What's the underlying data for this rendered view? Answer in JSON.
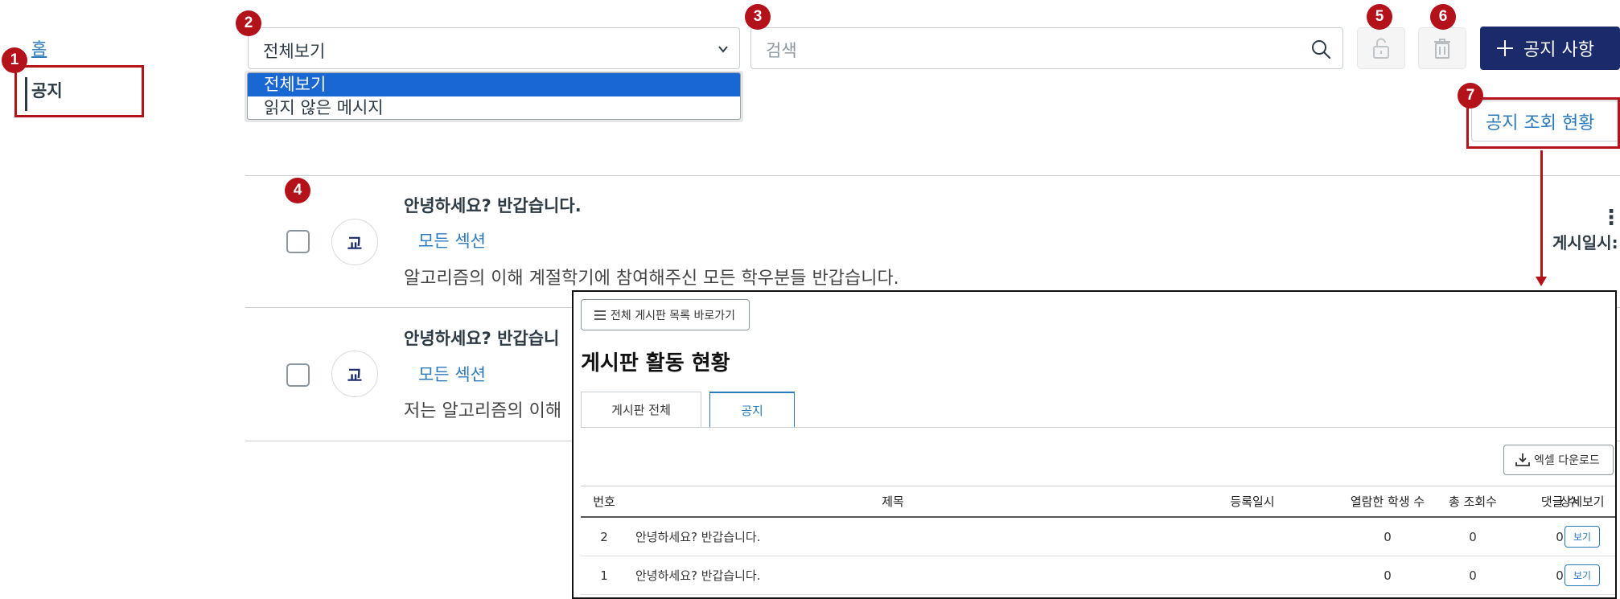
{
  "callouts": [
    "1",
    "2",
    "3",
    "4",
    "5",
    "6",
    "7"
  ],
  "nav": {
    "home": "홈",
    "notice": "공지"
  },
  "filter": {
    "selected": "전체보기",
    "options": [
      "전체보기",
      "읽지 않은 메시지"
    ]
  },
  "search": {
    "placeholder": "검색"
  },
  "toolbar": {
    "add_label": "공지 사항",
    "view_status_label": "공지 조회 현황"
  },
  "announcements": [
    {
      "avatar": "교",
      "title": "안녕하세요? 반갑습니다.",
      "section": "모든 섹션",
      "body": "알고리즘의 이해 계절학기에 참여해주신 모든 학우분들 반갑습니다.",
      "posted_label": "게시일시:"
    },
    {
      "avatar": "교",
      "title": "안녕하세요? 반갑습니",
      "section": "모든 섹션",
      "body": "저는 알고리즘의 이해"
    }
  ],
  "popup": {
    "back_label": "전체 게시판 목록 바로가기",
    "title": "게시판 활동 현황",
    "tabs": [
      "게시판 전체",
      "공지"
    ],
    "active_tab": "공지",
    "excel_label": "엑셀 다운로드",
    "columns": [
      "번호",
      "제목",
      "등록일시",
      "열람한 학생 수",
      "총 조회수",
      "댓글 수",
      "상세보기"
    ],
    "rows": [
      {
        "num": "2",
        "title": "안녕하세요? 반갑습니다.",
        "date": "",
        "viewers": "0",
        "total": "0",
        "comments": "0",
        "detail": "보기"
      },
      {
        "num": "1",
        "title": "안녕하세요? 반갑습니다.",
        "date": "",
        "viewers": "0",
        "total": "0",
        "comments": "0",
        "detail": "보기"
      }
    ]
  },
  "colors": {
    "callout": "#b4121b",
    "primary": "#1b2a6b",
    "link": "#2b7abc",
    "select_highlight": "#1967d2"
  }
}
